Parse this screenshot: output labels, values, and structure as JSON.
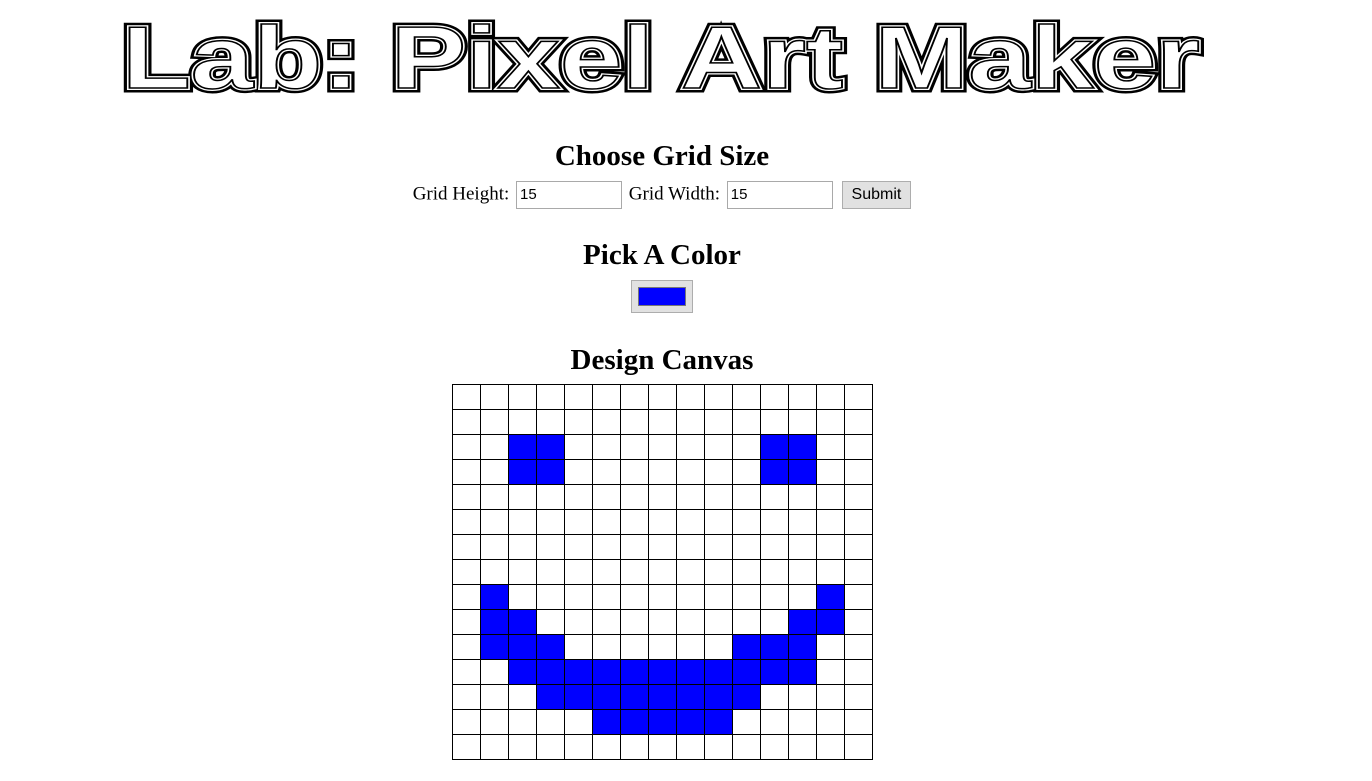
{
  "title": "Lab: Pixel Art Maker",
  "grid_section": {
    "heading": "Choose Grid Size",
    "height_label": "Grid Height:",
    "height_value": "15",
    "width_label": "Grid Width:",
    "width_value": "15",
    "submit_label": "Submit"
  },
  "color_section": {
    "heading": "Pick A Color",
    "selected_color": "#0000ff"
  },
  "canvas_section": {
    "heading": "Design Canvas",
    "rows": 15,
    "cols": 15,
    "fill_color": "#0000ff",
    "painted_cells": [
      [
        2,
        2
      ],
      [
        2,
        3
      ],
      [
        2,
        11
      ],
      [
        2,
        12
      ],
      [
        3,
        2
      ],
      [
        3,
        3
      ],
      [
        3,
        11
      ],
      [
        3,
        12
      ],
      [
        8,
        1
      ],
      [
        8,
        13
      ],
      [
        9,
        1
      ],
      [
        9,
        2
      ],
      [
        9,
        12
      ],
      [
        9,
        13
      ],
      [
        10,
        1
      ],
      [
        10,
        2
      ],
      [
        10,
        3
      ],
      [
        10,
        10
      ],
      [
        10,
        11
      ],
      [
        10,
        12
      ],
      [
        11,
        2
      ],
      [
        11,
        3
      ],
      [
        11,
        4
      ],
      [
        11,
        5
      ],
      [
        11,
        6
      ],
      [
        11,
        7
      ],
      [
        11,
        8
      ],
      [
        11,
        9
      ],
      [
        11,
        10
      ],
      [
        11,
        11
      ],
      [
        11,
        12
      ],
      [
        12,
        3
      ],
      [
        12,
        4
      ],
      [
        12,
        5
      ],
      [
        12,
        6
      ],
      [
        12,
        7
      ],
      [
        12,
        8
      ],
      [
        12,
        9
      ],
      [
        12,
        10
      ],
      [
        13,
        5
      ],
      [
        13,
        6
      ],
      [
        13,
        7
      ],
      [
        13,
        8
      ],
      [
        13,
        9
      ]
    ]
  }
}
